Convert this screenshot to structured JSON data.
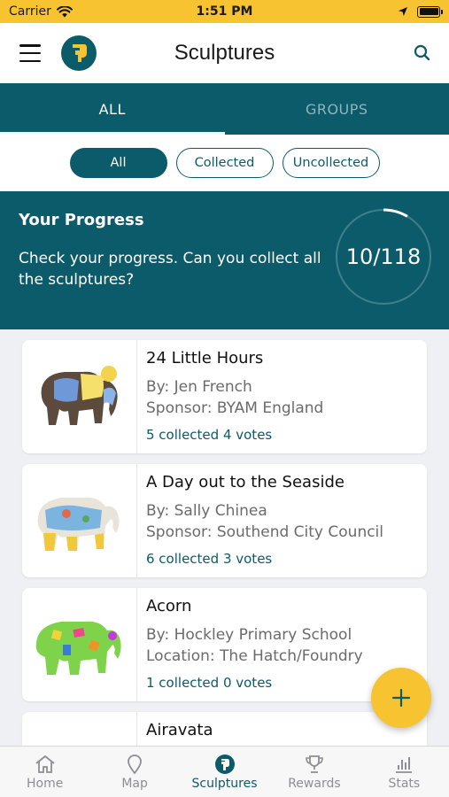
{
  "status_bar": {
    "carrier": "Carrier",
    "time": "1:51 PM"
  },
  "header": {
    "title": "Sculptures"
  },
  "tabs": [
    {
      "label": "ALL",
      "active": true
    },
    {
      "label": "GROUPS",
      "active": false
    }
  ],
  "filters": [
    {
      "label": "All",
      "active": true
    },
    {
      "label": "Collected",
      "active": false
    },
    {
      "label": "Uncollected",
      "active": false
    }
  ],
  "progress": {
    "title": "Your Progress",
    "description": "Check your progress. Can you collect all the sculptures?",
    "value_text": "10/118",
    "collected": 10,
    "total": 118
  },
  "sculptures": [
    {
      "name": "24 Little Hours",
      "line1": "By: Jen French",
      "line2": "Sponsor: BYAM England",
      "stats": "5 collected 4 votes"
    },
    {
      "name": "A Day out to the Seaside",
      "line1": "By: Sally Chinea",
      "line2": "Sponsor: Southend City Council",
      "stats": "6 collected 3 votes"
    },
    {
      "name": "Acorn",
      "line1": "By: Hockley Primary School",
      "line2": "Location: The Hatch/Foundry",
      "stats": "1 collected 0 votes"
    },
    {
      "name": "Airavata",
      "line1": "",
      "line2": "",
      "stats": ""
    }
  ],
  "bottom_nav": [
    {
      "label": "Home",
      "icon": "home-icon",
      "active": false
    },
    {
      "label": "Map",
      "icon": "map-pin-icon",
      "active": false
    },
    {
      "label": "Sculptures",
      "icon": "sculptures-icon",
      "active": true
    },
    {
      "label": "Rewards",
      "icon": "trophy-icon",
      "active": false
    },
    {
      "label": "Stats",
      "icon": "stats-icon",
      "active": false
    }
  ],
  "colors": {
    "brand": "#0b5b6a",
    "accent": "#f7c331",
    "background": "#eef0f3"
  }
}
